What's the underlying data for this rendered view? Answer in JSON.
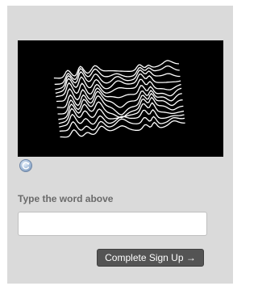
{
  "captcha": {
    "image_alt": "captcha-waves",
    "refresh_icon": "refresh-icon"
  },
  "form": {
    "label": "Type the word above",
    "input_value": "",
    "input_placeholder": "",
    "submit_label": "Complete Sign Up →"
  },
  "colors": {
    "panel_bg": "#dadada",
    "captcha_bg": "#000000",
    "captcha_lines": "#ffffff",
    "button_bg": "#545454",
    "label_color": "#6a6a6a"
  }
}
